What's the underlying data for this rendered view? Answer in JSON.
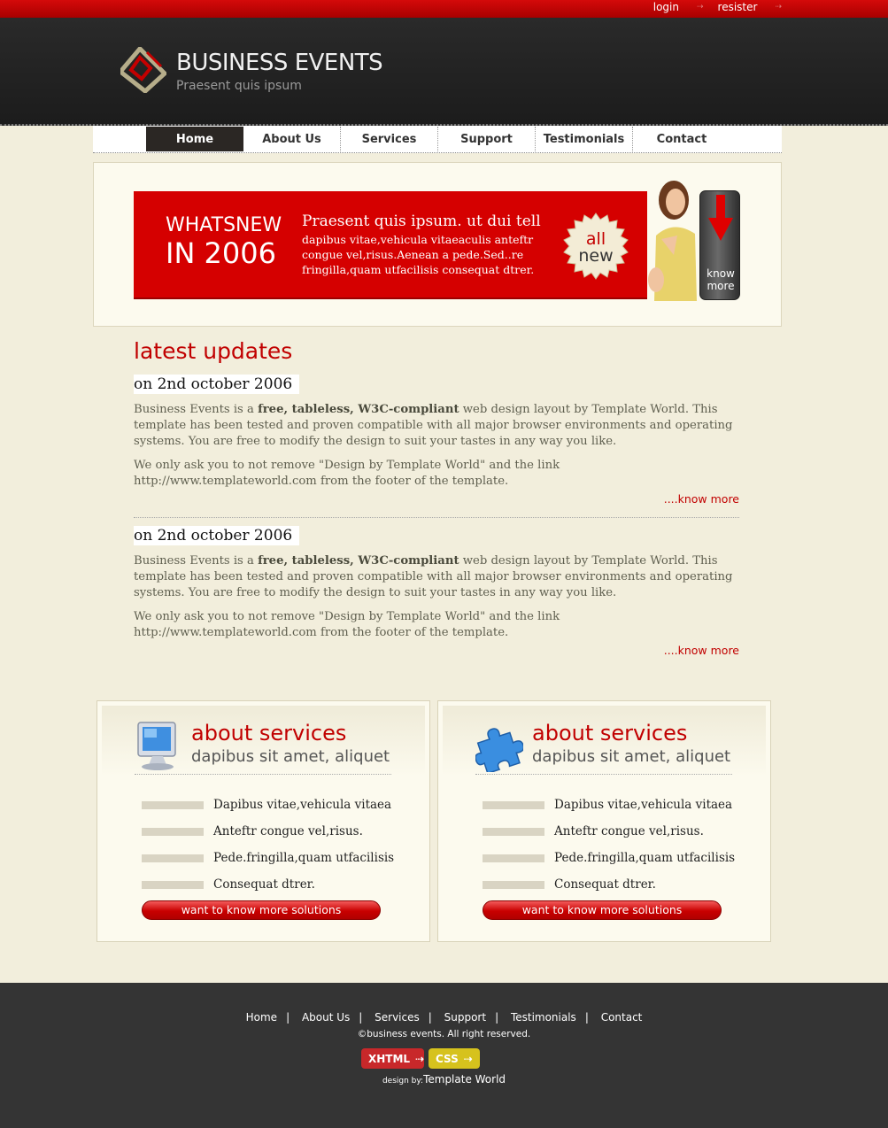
{
  "topbar": {
    "login": "login",
    "register": "resister"
  },
  "header": {
    "brand": "BUSINESS EVENTS",
    "tagline": "Praesent quis ipsum"
  },
  "nav": {
    "items": [
      "Home",
      "About Us",
      "Services",
      "Support",
      "Testimonials",
      "Contact"
    ],
    "active": "Home"
  },
  "banner": {
    "whatsnew": "WHATSNEW",
    "year": "IN 2006",
    "title": "Praesent quis ipsum. ut dui tell",
    "text": "dapibus vitae,vehicula vitaeaculis anteftr congue vel,risus.Aenean a pede.Sed..re fringilla,quam utfacilisis consequat dtrer.",
    "seal_line1": "all",
    "seal_line2": "new",
    "know_line1": "know",
    "know_line2": "more"
  },
  "latest": {
    "heading": "latest updates",
    "posts": [
      {
        "date": "on 2nd october 2006",
        "p1_before": "Business Events is a ",
        "p1_bold": "free, tableless, W3C-compliant",
        "p1_after": " web design layout by Template World. This template has been tested and proven compatible with all major browser environments and operating systems. You are free to modify the design to suit your tastes in any way you like.",
        "p2": "We only ask you to not remove \"Design by Template World\" and the link http://www.templateworld.com from the footer of the template.",
        "more": "....know more"
      },
      {
        "date": "on 2nd october 2006",
        "p1_before": "Business Events is a ",
        "p1_bold": "free, tableless, W3C-compliant",
        "p1_after": " web design layout by Template World. This template has been tested and proven compatible with all major browser environments and operating systems. You are free to modify the design to suit your tastes in any way you like.",
        "p2": "We only ask you to not remove \"Design by Template World\" and the link http://www.templateworld.com from the footer of the template.",
        "more": "....know more"
      }
    ]
  },
  "services": [
    {
      "icon": "monitor-icon",
      "title": "about services",
      "subtitle": "dapibus sit amet, aliquet",
      "items": [
        "Dapibus vitae,vehicula vitaea",
        "Anteftr congue vel,risus.",
        "Pede.fringilla,quam utfacilisis",
        "Consequat dtrer."
      ],
      "button": "want to know more solutions"
    },
    {
      "icon": "puzzle-icon",
      "title": "about services",
      "subtitle": "dapibus sit amet, aliquet",
      "items": [
        "Dapibus vitae,vehicula vitaea",
        "Anteftr congue vel,risus.",
        "Pede.fringilla,quam utfacilisis",
        "Consequat dtrer."
      ],
      "button": "want to know more solutions"
    }
  ],
  "footer": {
    "nav": [
      "Home",
      "About Us",
      "Services",
      "Support",
      "Testimonials",
      "Contact"
    ],
    "separator": "|",
    "copyright": "©business events. All right reserved.",
    "badge_xhtml": "XHTML",
    "badge_css": "CSS",
    "design_by_label": "design by:",
    "design_by": "Template World"
  },
  "colors": {
    "accent": "#d50000",
    "header": "#1f1f1f",
    "page": "#f2eedc",
    "footer": "#343434"
  }
}
